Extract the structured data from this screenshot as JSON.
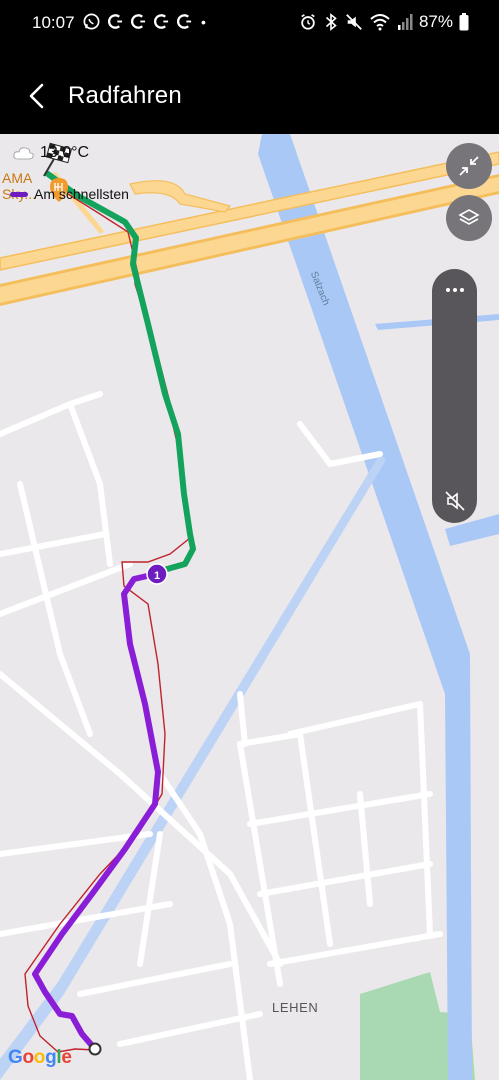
{
  "status_bar": {
    "time": "10:07",
    "battery": "87%",
    "dot": "•"
  },
  "app_bar": {
    "title": "Radfahren"
  },
  "map": {
    "weather_temp": "13,0°C",
    "route_legend_label": "Am schnellsten",
    "route_color": "#8a1ed6",
    "traveled_color": "#14a35c",
    "poi_label_line1": "AMA",
    "poi_label_line2": "Sky...",
    "district_label": "LEHEN",
    "river_label": "Salzach",
    "waypoint_number": "1",
    "attribution_letters": [
      "G",
      "o",
      "o",
      "g",
      "l",
      "e"
    ]
  },
  "colors": {
    "water": "#aac8f6",
    "highway": "#fcd791",
    "park": "#a9d9b3",
    "land": "#ebe8ec"
  }
}
